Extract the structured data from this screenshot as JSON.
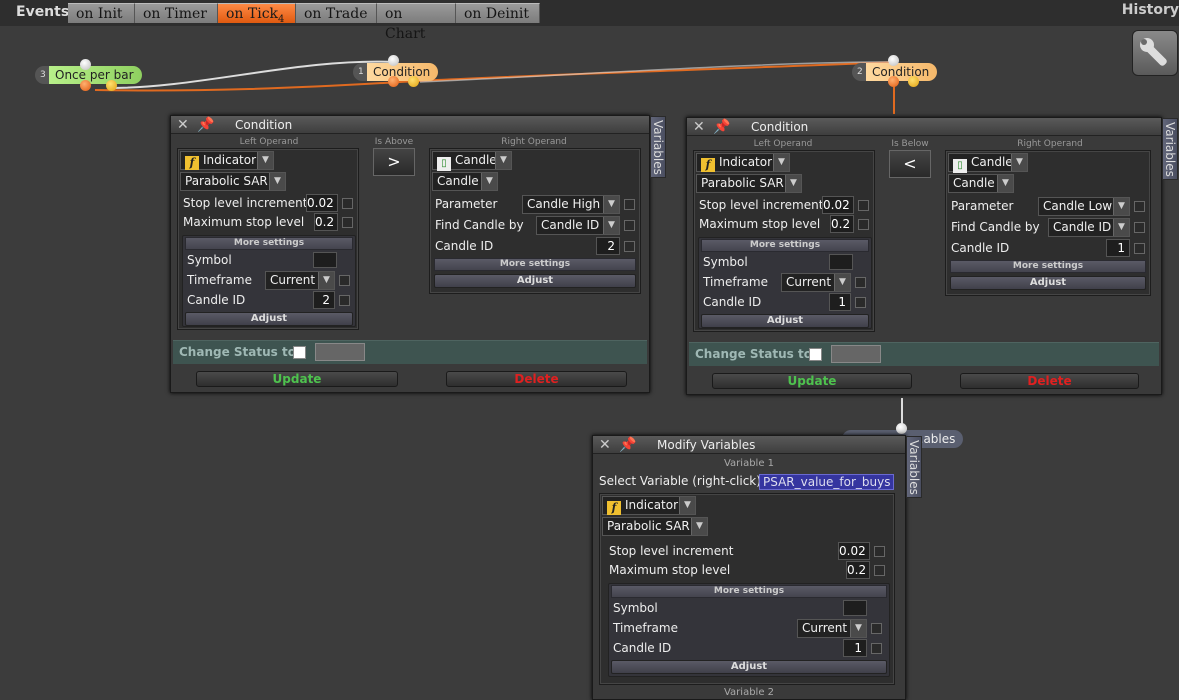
{
  "topbar": {
    "events_label": "Events",
    "tabs": [
      {
        "label": "on Init"
      },
      {
        "label": "on Timer"
      },
      {
        "label": "on Tick",
        "badge": "4"
      },
      {
        "label": "on Trade"
      },
      {
        "label": "on Chart"
      },
      {
        "label": "on Deinit"
      }
    ],
    "history": "History"
  },
  "flow": {
    "nodes": [
      {
        "num": "3",
        "label": "Once per bar"
      },
      {
        "num": "1",
        "label": "Condition"
      },
      {
        "num": "2",
        "label": "Condition"
      },
      {
        "label": "...ables"
      }
    ]
  },
  "condition1": {
    "title": "Condition",
    "variables_tab": "Variables",
    "left_operand_caption": "Left Operand",
    "operator_caption": "Is Above",
    "right_operand_caption": "Right Operand",
    "operator": ">",
    "left": {
      "type": "Indicator",
      "indicator": "Parabolic SAR",
      "params": [
        {
          "label": "Stop level increment",
          "value": "0.02"
        },
        {
          "label": "Maximum stop level",
          "value": "0.2"
        }
      ],
      "more_settings": "More settings",
      "symbol_label": "Symbol",
      "timeframe_label": "Timeframe",
      "timeframe_value": "Current",
      "candle_id_label": "Candle ID",
      "candle_id_value": "2",
      "adjust": "Adjust"
    },
    "right": {
      "type": "Candle",
      "source": "Candle",
      "parameter_label": "Parameter",
      "parameter_value": "Candle High",
      "find_by_label": "Find Candle by",
      "find_by_value": "Candle ID",
      "candle_id_label": "Candle ID",
      "candle_id_value": "2",
      "more_settings": "More settings",
      "adjust": "Adjust"
    },
    "change_status_label": "Change Status to",
    "update": "Update",
    "delete": "Delete"
  },
  "condition2": {
    "title": "Condition",
    "variables_tab": "Variables",
    "left_operand_caption": "Left Operand",
    "operator_caption": "Is Below",
    "right_operand_caption": "Right Operand",
    "operator": "<",
    "left": {
      "type": "Indicator",
      "indicator": "Parabolic SAR",
      "params": [
        {
          "label": "Stop level increment",
          "value": "0.02"
        },
        {
          "label": "Maximum stop level",
          "value": "0.2"
        }
      ],
      "more_settings": "More settings",
      "symbol_label": "Symbol",
      "timeframe_label": "Timeframe",
      "timeframe_value": "Current",
      "candle_id_label": "Candle ID",
      "candle_id_value": "1",
      "adjust": "Adjust"
    },
    "right": {
      "type": "Candle",
      "source": "Candle",
      "parameter_label": "Parameter",
      "parameter_value": "Candle Low",
      "find_by_label": "Find Candle by",
      "find_by_value": "Candle ID",
      "candle_id_label": "Candle ID",
      "candle_id_value": "1",
      "more_settings": "More settings",
      "adjust": "Adjust"
    },
    "change_status_label": "Change Status to",
    "update": "Update",
    "delete": "Delete"
  },
  "modify": {
    "title": "Modify Variables",
    "variables_tab": "Variables",
    "variable1_caption": "Variable 1",
    "select_label": "Select Variable (right-click)",
    "selected_variable": "PSAR_value_for_buys",
    "type": "Indicator",
    "indicator": "Parabolic SAR",
    "params": [
      {
        "label": "Stop level increment",
        "value": "0.02"
      },
      {
        "label": "Maximum stop level",
        "value": "0.2"
      }
    ],
    "more_settings": "More settings",
    "symbol_label": "Symbol",
    "timeframe_label": "Timeframe",
    "timeframe_value": "Current",
    "candle_id_label": "Candle ID",
    "candle_id_value": "1",
    "adjust": "Adjust",
    "variable2_caption": "Variable 2"
  }
}
